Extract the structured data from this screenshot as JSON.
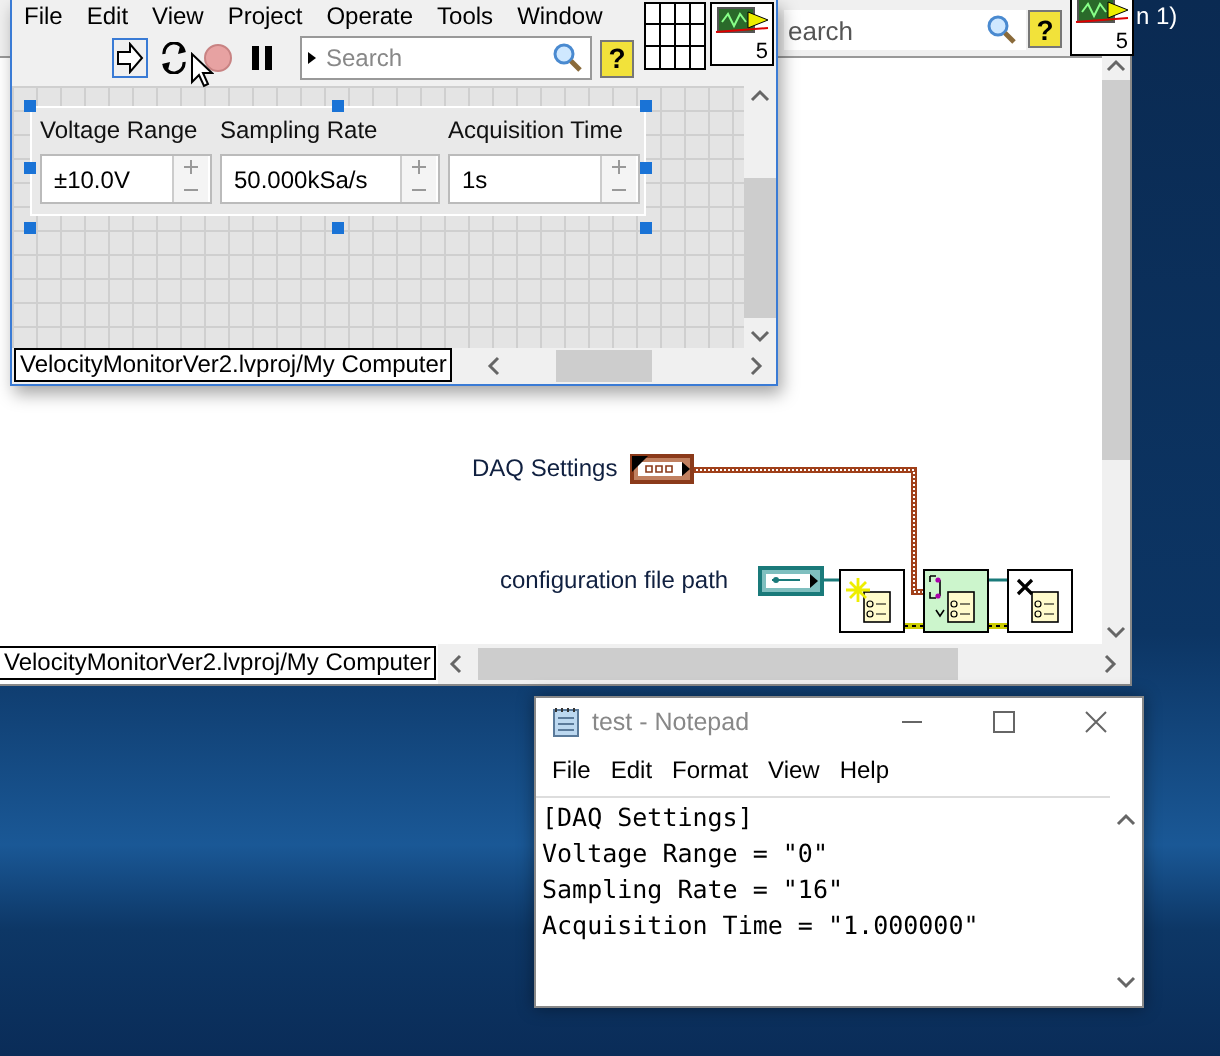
{
  "desktop": {
    "title_fragment": "n 1)"
  },
  "block_diagram": {
    "search_text": "earch",
    "help_label": "?",
    "vi_label": "5",
    "terminals": [
      {
        "kind": "cluster",
        "label": "DAQ Settings"
      },
      {
        "kind": "path",
        "label": "configuration file path"
      }
    ],
    "nodes": [
      {
        "kind": "open"
      },
      {
        "kind": "write"
      },
      {
        "kind": "close"
      }
    ],
    "status": "VelocityMonitorVer2.lvproj/My Computer"
  },
  "front_panel": {
    "menu": [
      "File",
      "Edit",
      "View",
      "Project",
      "Operate",
      "Tools",
      "Window"
    ],
    "toolbar": [
      {
        "kind": "run",
        "selected": true,
        "disabled": false
      },
      {
        "kind": "run-continuously",
        "selected": false,
        "disabled": false
      },
      {
        "kind": "abort",
        "selected": false,
        "disabled": true
      },
      {
        "kind": "pause",
        "selected": false,
        "disabled": false
      }
    ],
    "search": {
      "placeholder": "Search"
    },
    "help_label": "?",
    "connector_label": "5",
    "controls": [
      {
        "label": "Voltage Range",
        "value": "±10.0V"
      },
      {
        "label": "Sampling Rate",
        "value": "50.000kSa/s"
      },
      {
        "label": "Acquisition Time",
        "value": "1s"
      }
    ],
    "status": "VelocityMonitorVer2.lvproj/My Computer"
  },
  "notepad": {
    "title": "test - Notepad",
    "menu": [
      "File",
      "Edit",
      "Format",
      "View",
      "Help"
    ],
    "lines": [
      "[DAQ Settings]",
      "Voltage Range = \"0\"",
      "Sampling Rate = \"16\"",
      "Acquisition Time = \"1.000000\""
    ]
  }
}
